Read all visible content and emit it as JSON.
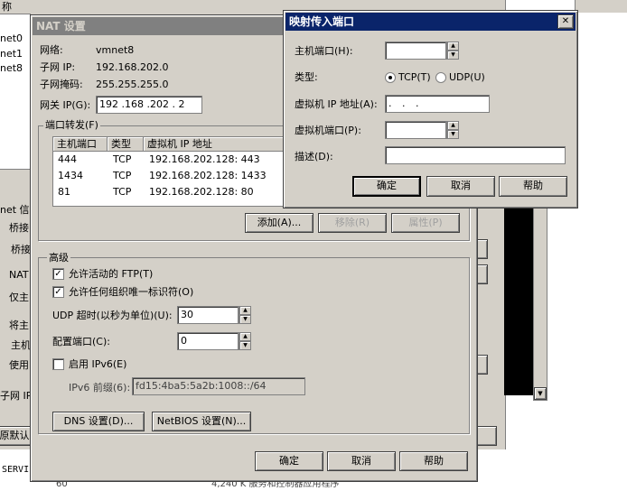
{
  "background": {
    "list_header": "称",
    "list_items": [
      "net0",
      "net1",
      "net8"
    ],
    "side_labels": [
      "net 信",
      "桥接",
      "桥接",
      "NAT",
      "仅主",
      "将主",
      "主机",
      "使用"
    ],
    "subnet_label": "子网 IP (",
    "restore_label": "原默认",
    "bottom_text_1": "SERVI",
    "bottom_text_2": "60",
    "bottom_text_3": "4,240 K   服务和控制器应用程序"
  },
  "nat_dialog": {
    "title": "NAT 设置",
    "network_label": "网络:",
    "network_value": "vmnet8",
    "subnet_ip_label": "子网 IP:",
    "subnet_ip_value": "192.168.202.0",
    "subnet_mask_label": "子网掩码:",
    "subnet_mask_value": "255.255.255.0",
    "gateway_label": "网关 IP(G):",
    "gateway_value": "192 .168 .202 . 2",
    "port_forward_group": "端口转发(F)",
    "columns": [
      "主机端口",
      "类型",
      "虚拟机 IP 地址"
    ],
    "rows": [
      {
        "port": "444",
        "type": "TCP",
        "ip": "192.168.202.128: 443"
      },
      {
        "port": "1434",
        "type": "TCP",
        "ip": "192.168.202.128: 1433"
      },
      {
        "port": "81",
        "type": "TCP",
        "ip": "192.168.202.128: 80"
      }
    ],
    "add_button": "添加(A)...",
    "remove_button": "移除(R)",
    "properties_button": "属性(P)",
    "advanced_group": "高级",
    "allow_ftp_label": "允许活动的 FTP(T)",
    "allow_ftp_checked": true,
    "allow_oui_label": "允许任何组织唯一标识符(O)",
    "allow_oui_checked": true,
    "udp_timeout_label": "UDP 超时(以秒为单位)(U):",
    "udp_timeout_value": "30",
    "config_port_label": "配置端口(C):",
    "config_port_value": "0",
    "enable_ipv6_label": "启用 IPv6(E)",
    "enable_ipv6_checked": false,
    "ipv6_prefix_label": "IPv6 前缀(6):",
    "ipv6_prefix_value": "fd15:4ba5:5a2b:1008::/64",
    "dns_button": "DNS 设置(D)...",
    "netbios_button": "NetBIOS 设置(N)...",
    "ok_button": "确定",
    "cancel_button": "取消",
    "help_button": "帮助"
  },
  "map_dialog": {
    "title": "映射传入端口",
    "close_glyph": "✕",
    "host_port_label": "主机端口(H):",
    "host_port_value": "",
    "type_label": "类型:",
    "tcp_label": "TCP(T)",
    "udp_label": "UDP(U)",
    "selected_type": "TCP",
    "vm_ip_label": "虚拟机 IP 地址(A):",
    "vm_ip_value": " .     .     .",
    "vm_port_label": "虚拟机端口(P):",
    "vm_port_value": "",
    "desc_label": "描述(D):",
    "desc_value": "",
    "ok_button": "确定",
    "cancel_button": "取消",
    "help_button": "帮助"
  },
  "colors": {
    "face": "#d4d0c8",
    "title_active": "#0a246a",
    "title_inactive": "#808080"
  }
}
